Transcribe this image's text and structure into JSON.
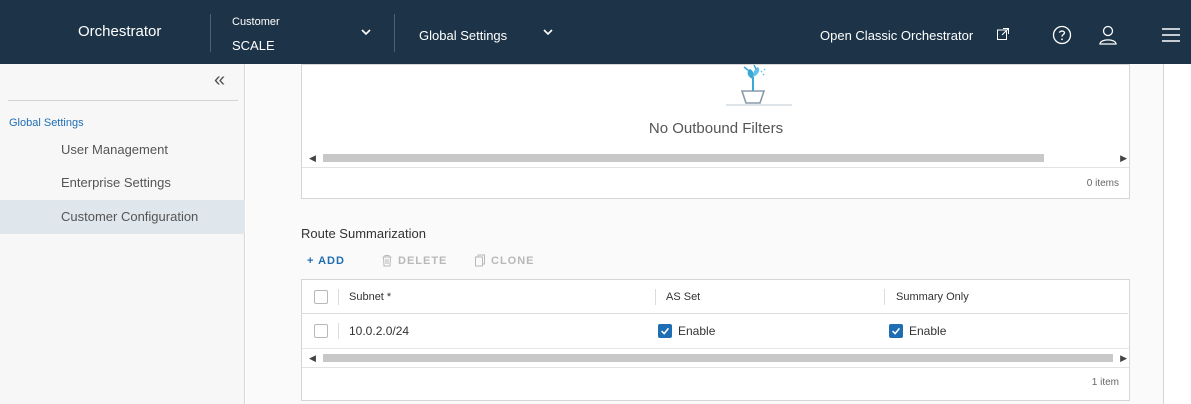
{
  "header": {
    "app_title": "Orchestrator",
    "customer_label": "Customer",
    "customer_value": "SCALE",
    "global_settings": "Global Settings",
    "classic_link": "Open Classic Orchestrator",
    "background_color": "#1d3448"
  },
  "sidebar": {
    "section": "Global Settings",
    "items": [
      {
        "label": "User Management",
        "active": false
      },
      {
        "label": "Enterprise Settings",
        "active": false
      },
      {
        "label": "Customer Configuration",
        "active": true
      }
    ]
  },
  "outbound_filters": {
    "empty_message": "No Outbound Filters",
    "count": "0 items"
  },
  "route_summarization": {
    "title": "Route Summarization",
    "actions": [
      {
        "label": "+ ADD",
        "enabled": true
      },
      {
        "label": "DELETE",
        "enabled": false,
        "icon": "trash-icon"
      },
      {
        "label": "CLONE",
        "enabled": false,
        "icon": "copy-icon"
      }
    ],
    "columns": [
      "Subnet *",
      "AS Set",
      "Summary Only"
    ],
    "rows": [
      {
        "subnet": "10.0.2.0/24",
        "as_set": "Enable",
        "as_set_checked": true,
        "summary_only": "Enable",
        "summary_only_checked": true
      }
    ],
    "count": "1 item"
  },
  "colors": {
    "accent": "#1f6eb3",
    "active_nav": "#dfe6ec"
  }
}
